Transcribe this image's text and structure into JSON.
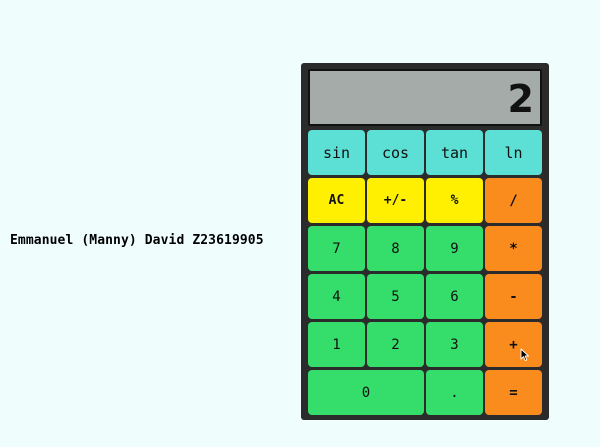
{
  "author": "Emmanuel (Manny) David Z23619905",
  "display": "2",
  "colors": {
    "background": "#effdfd",
    "calculator_body": "#2b2b2b",
    "display": "#a5aba8",
    "scientific": "#5cdfd5",
    "function": "#fef000",
    "operator": "#fa8c1e",
    "number": "#35dd6a"
  },
  "buttons": {
    "sin": "sin",
    "cos": "cos",
    "tan": "tan",
    "ln": "ln",
    "ac": "AC",
    "sign": "+/-",
    "percent": "%",
    "divide": "/",
    "seven": "7",
    "eight": "8",
    "nine": "9",
    "multiply": "*",
    "four": "4",
    "five": "5",
    "six": "6",
    "subtract": "-",
    "one": "1",
    "two": "2",
    "three": "3",
    "add": "+",
    "zero": "0",
    "decimal": ".",
    "equals": "="
  },
  "icons": {
    "cursor": "mouse-pointer-icon"
  }
}
